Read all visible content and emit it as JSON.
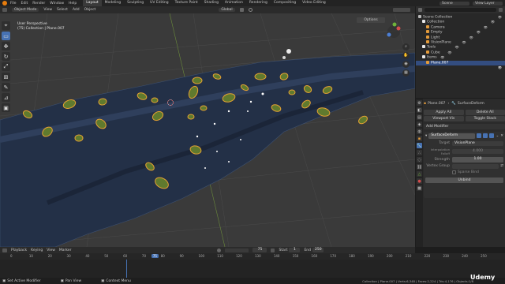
{
  "topbar": {
    "menus": [
      "File",
      "Edit",
      "Render",
      "Window",
      "Help"
    ],
    "tabs": [
      "Layout",
      "Modeling",
      "Sculpting",
      "UV Editing",
      "Texture Paint",
      "Shading",
      "Animation",
      "Rendering",
      "Compositing",
      "Video Editing"
    ],
    "active_tab": "Layout",
    "scene_label": "Scene",
    "view_layer_label": "View Layer"
  },
  "viewport_header": {
    "mode": "Object Mode",
    "menus": [
      "View",
      "Select",
      "Add",
      "Object"
    ],
    "orientation": "Global",
    "options_label": "Options"
  },
  "viewport": {
    "view_name": "User Perspective",
    "collection_info": "(75) Collection | Plane.007"
  },
  "toolbar": {
    "tools": [
      "cursor",
      "select-box",
      "move",
      "rotate",
      "scale",
      "transform",
      "annotate",
      "measure",
      "add-cube"
    ]
  },
  "outliner": {
    "title": "Scene Collection",
    "items": [
      {
        "label": "Scene Collection",
        "indent": 0,
        "icon_color": "#b8b8b8",
        "selected": false
      },
      {
        "label": "Collection",
        "indent": 1,
        "icon_color": "#e8e8e8",
        "selected": false
      },
      {
        "label": "Camera",
        "indent": 2,
        "icon_color": "#e39b3b",
        "selected": false
      },
      {
        "label": "Empty",
        "indent": 2,
        "icon_color": "#e39b3b",
        "selected": false
      },
      {
        "label": "Light",
        "indent": 2,
        "icon_color": "#e39b3b",
        "selected": false
      },
      {
        "label": "VisionPlane",
        "indent": 2,
        "icon_color": "#e39b3b",
        "selected": false
      },
      {
        "label": "Tools",
        "indent": 1,
        "icon_color": "#e8e8e8",
        "selected": false
      },
      {
        "label": "Cube",
        "indent": 2,
        "icon_color": "#e39b3b",
        "selected": false
      },
      {
        "label": "Items",
        "indent": 1,
        "icon_color": "#e8e8e8",
        "selected": false
      },
      {
        "label": "Plane.007",
        "indent": 2,
        "icon_color": "#e39b3b",
        "selected": true
      }
    ]
  },
  "properties": {
    "object_name": "Plane.007",
    "modifier_name": "SurfaceDeform",
    "apply_all": "Apply All",
    "delete_all": "Delete All",
    "viewport_vis": "Viewport Vis",
    "toggle_stack": "Toggle Stack",
    "add_modifier": "Add Modifier",
    "mod_field_name": "SurfaceDeform",
    "target_label": "Target",
    "target_value": "VisionPlane",
    "interp_label": "Interpolation Falloff",
    "interp_value": "4.000",
    "strength_label": "Strength",
    "strength_value": "1.00",
    "vgroup_label": "Vertex Group",
    "sparse_bind": "Sparse Bind",
    "unbind_label": "Unbind"
  },
  "timeline_header": {
    "menus": [
      "Playback",
      "Keying",
      "View",
      "Marker"
    ],
    "current_frame": "75",
    "start_label": "Start",
    "start_value": "1",
    "end_label": "End",
    "end_value": "250"
  },
  "timeline": {
    "ticks": [
      "0",
      "10",
      "20",
      "30",
      "40",
      "50",
      "60",
      "70",
      "75",
      "80",
      "90",
      "100",
      "110",
      "120",
      "130",
      "140",
      "150",
      "160",
      "170",
      "180",
      "190",
      "200",
      "210",
      "220",
      "230",
      "240",
      "250"
    ]
  },
  "statusbar": {
    "left1": "Set Active Modifier",
    "left2": "Pan View",
    "left3": "Context Menu",
    "right": "Collection | Plane.007 | Verts:6,348 | Faces:2,224 | Tris:4,176 | Objects:1/8",
    "watermark": "Udemy"
  }
}
